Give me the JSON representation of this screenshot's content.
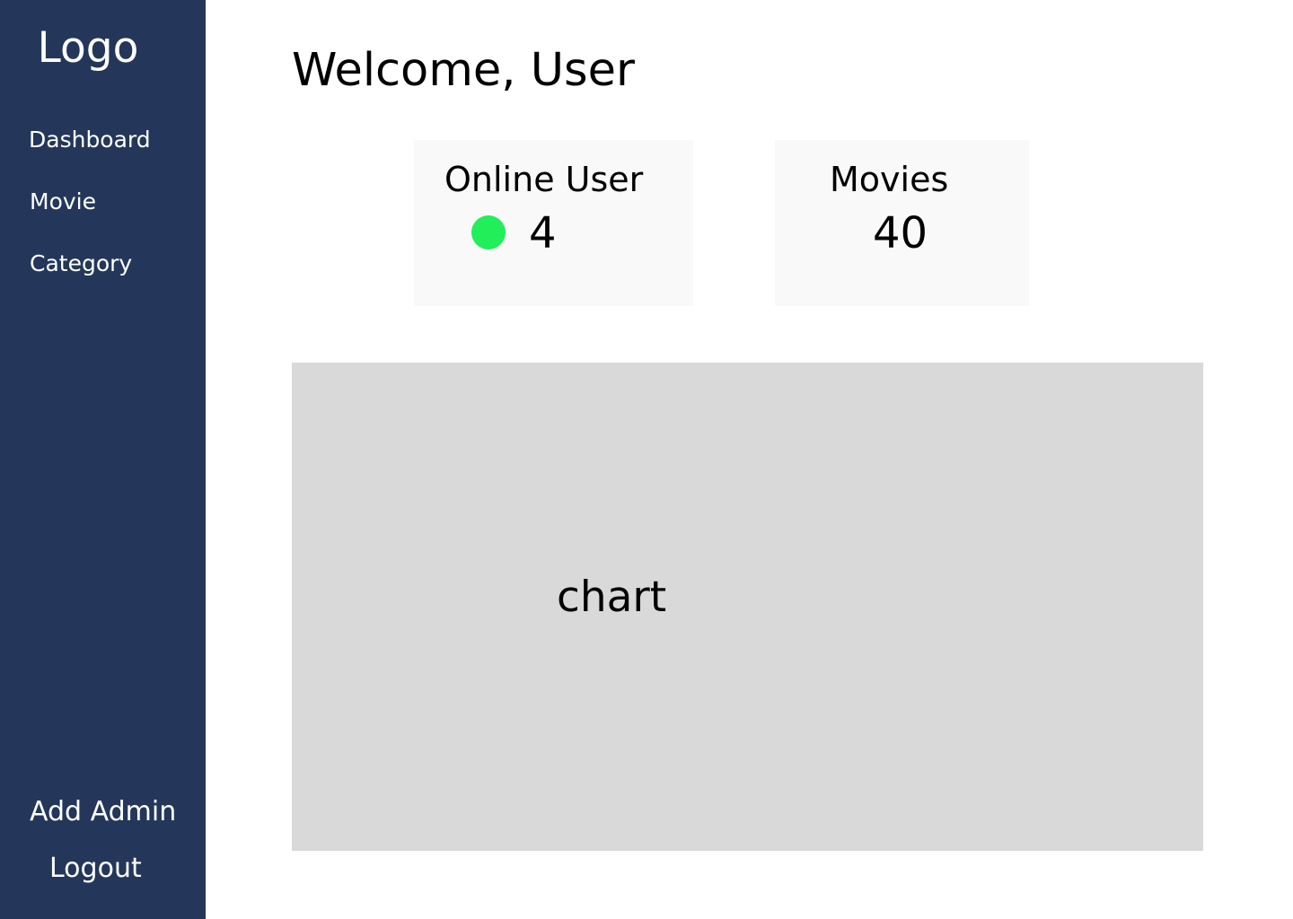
{
  "sidebar": {
    "logo": "Logo",
    "nav_items": [
      {
        "label": "Dashboard"
      },
      {
        "label": "Movie"
      },
      {
        "label": "Category"
      }
    ],
    "add_admin": "Add Admin",
    "logout": "Logout",
    "background_color": "#24375a"
  },
  "main": {
    "title": "Welcome, User",
    "cards": [
      {
        "title": "Online User",
        "value": "4",
        "status_color": "#22ee5a",
        "icon": "online-status-dot"
      },
      {
        "title": "Movies",
        "value": "40"
      }
    ],
    "chart_placeholder": "chart"
  }
}
